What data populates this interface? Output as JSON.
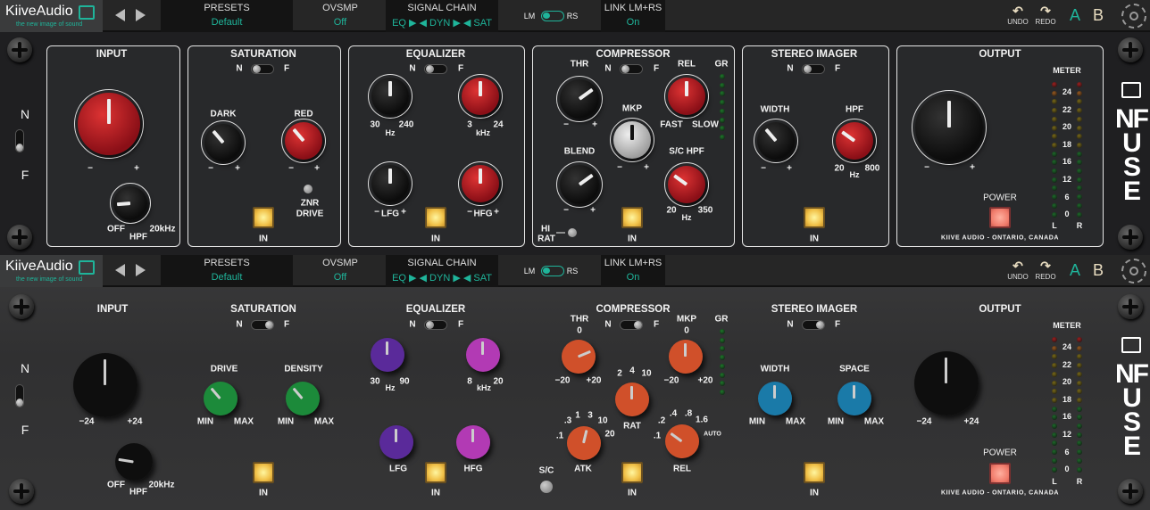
{
  "colors": {
    "accent": "#1fb49a",
    "panel": "#28292b"
  },
  "header": {
    "brand": "KiiveAudio",
    "tagline": "the new image of sound",
    "presets_label": "PRESETS",
    "preset_value": "Default",
    "ovsmp_label": "OVSMP",
    "ovsmp_value": "Off",
    "chain_label": "SIGNAL CHAIN",
    "chain_value": "EQ ▶ ◀ DYN ▶ ◀ SAT",
    "lm": "LM",
    "rs": "RS",
    "link_label": "LINK LM+RS",
    "link_value": "On",
    "undo": "UNDO",
    "redo": "REDO",
    "a": "A",
    "b": "B"
  },
  "top": {
    "nf": {
      "n": "N",
      "f": "F",
      "state": "F"
    },
    "input": {
      "title": "INPUT",
      "minus": "−",
      "plus": "+",
      "gain": 0.5,
      "hpf": 0.15,
      "off": "OFF",
      "hpf_label": "HPF",
      "max": "20kHz"
    },
    "sat": {
      "title": "SATURATION",
      "n": "N",
      "f": "F",
      "state": "N",
      "dark": "DARK",
      "red": "RED",
      "dark_val": 0.35,
      "red_val": 0.35,
      "minus": "−",
      "plus": "+",
      "znr": "ZNR",
      "drive": "DRIVE",
      "in": "IN"
    },
    "eq": {
      "title": "EQUALIZER",
      "n": "N",
      "f": "F",
      "state": "N",
      "lf_min": "30",
      "lf_max": "240",
      "hz": "Hz",
      "hf_min": "3",
      "hf_max": "24",
      "khz": "kHz",
      "lfg": "LFG",
      "hfg": "HFG",
      "minus": "−",
      "plus": "+",
      "lf": 0.5,
      "hf": 0.5,
      "lfg_val": 0.5,
      "hfg_val": 0.5,
      "in": "IN"
    },
    "comp": {
      "title": "COMPRESSOR",
      "n": "N",
      "f": "F",
      "state": "N",
      "thr": "THR",
      "rel": "REL",
      "mkp": "MKP",
      "blend": "BLEND",
      "schpf": "S/C HPF",
      "gr": "GR",
      "fast": "FAST",
      "slow": "SLOW",
      "min20": "20",
      "max350": "350",
      "hz": "Hz",
      "minus": "−",
      "plus": "+",
      "hi": "HI",
      "rat": "RAT",
      "dash": "—",
      "thr_val": 0.7,
      "rel_val": 0.5,
      "mkp_val": 0.5,
      "blend_val": 0.7,
      "schpf_val": 0.3,
      "in": "IN"
    },
    "stereo": {
      "title": "STEREO IMAGER",
      "n": "N",
      "f": "F",
      "state": "N",
      "width": "WIDTH",
      "hpf": "HPF",
      "minus": "−",
      "plus": "+",
      "min20": "20",
      "max800": "800",
      "hz": "Hz",
      "width_val": 0.35,
      "hpf_val": 0.3,
      "in": "IN"
    },
    "output": {
      "title": "OUTPUT",
      "minus": "−",
      "plus": "+",
      "gain": 0.5,
      "meter": "METER",
      "scale": [
        "24",
        "22",
        "20",
        "18",
        "16",
        "12",
        "6",
        "0"
      ],
      "l": "L",
      "r": "R",
      "power": "POWER",
      "credit": "KIIVE AUDIO - ONTARIO, CANADA"
    },
    "brand": "NFUSE"
  },
  "bottom": {
    "nf": {
      "n": "N",
      "f": "F",
      "state": "F"
    },
    "input": {
      "title": "INPUT",
      "min": "−24",
      "max": "+24",
      "gain": 0.5,
      "hpf": 0.2,
      "off": "OFF",
      "hpf_label": "HPF",
      "hmax": "20kHz"
    },
    "sat": {
      "title": "SATURATION",
      "n": "N",
      "f": "F",
      "state": "F",
      "drive": "DRIVE",
      "density": "DENSITY",
      "min": "MIN",
      "max": "MAX",
      "drive_val": 0.35,
      "density_val": 0.35,
      "in": "IN"
    },
    "eq": {
      "title": "EQUALIZER",
      "n": "N",
      "f": "F",
      "state": "N",
      "lf_min": "30",
      "lf_max": "90",
      "hz": "Hz",
      "hf_min": "8",
      "hf_max": "20",
      "khz": "kHz",
      "lfg": "LFG",
      "hfg": "HFG",
      "lf": 0.5,
      "hf": 0.5,
      "lfg_val": 0.5,
      "hfg_val": 0.5,
      "in": "IN"
    },
    "comp": {
      "title": "COMPRESSOR",
      "n": "N",
      "f": "F",
      "state": "F",
      "thr": "THR",
      "mkp": "MKP",
      "zero": "0",
      "m20": "−20",
      "p20": "+20",
      "gr": "GR",
      "rat": "RAT",
      "rat_scale": [
        "2",
        "4",
        "10"
      ],
      "atk": "ATK",
      "atk_scale": [
        ".1",
        ".3",
        "1",
        "3",
        "10",
        "20"
      ],
      "rel": "REL",
      "rel_scale": [
        ".1",
        ".2",
        ".4",
        ".8",
        "1.6",
        "AUTO"
      ],
      "sc": "S/C",
      "thr_val": 0.75,
      "mkp_val": 0.5,
      "rat_val": 0.5,
      "atk_val": 0.55,
      "rel_val": 0.3,
      "in": "IN"
    },
    "stereo": {
      "title": "STEREO IMAGER",
      "n": "N",
      "f": "F",
      "state": "F",
      "width": "WIDTH",
      "space": "SPACE",
      "min": "MIN",
      "max": "MAX",
      "width_val": 0.5,
      "space_val": 0.5,
      "in": "IN"
    },
    "output": {
      "title": "OUTPUT",
      "min": "−24",
      "max": "+24",
      "gain": 0.5,
      "meter": "METER",
      "scale": [
        "24",
        "22",
        "20",
        "18",
        "16",
        "12",
        "6",
        "0"
      ],
      "l": "L",
      "r": "R",
      "power": "POWER",
      "credit": "KIIVE AUDIO - ONTARIO, CANADA"
    },
    "brand": "NFUSE"
  }
}
